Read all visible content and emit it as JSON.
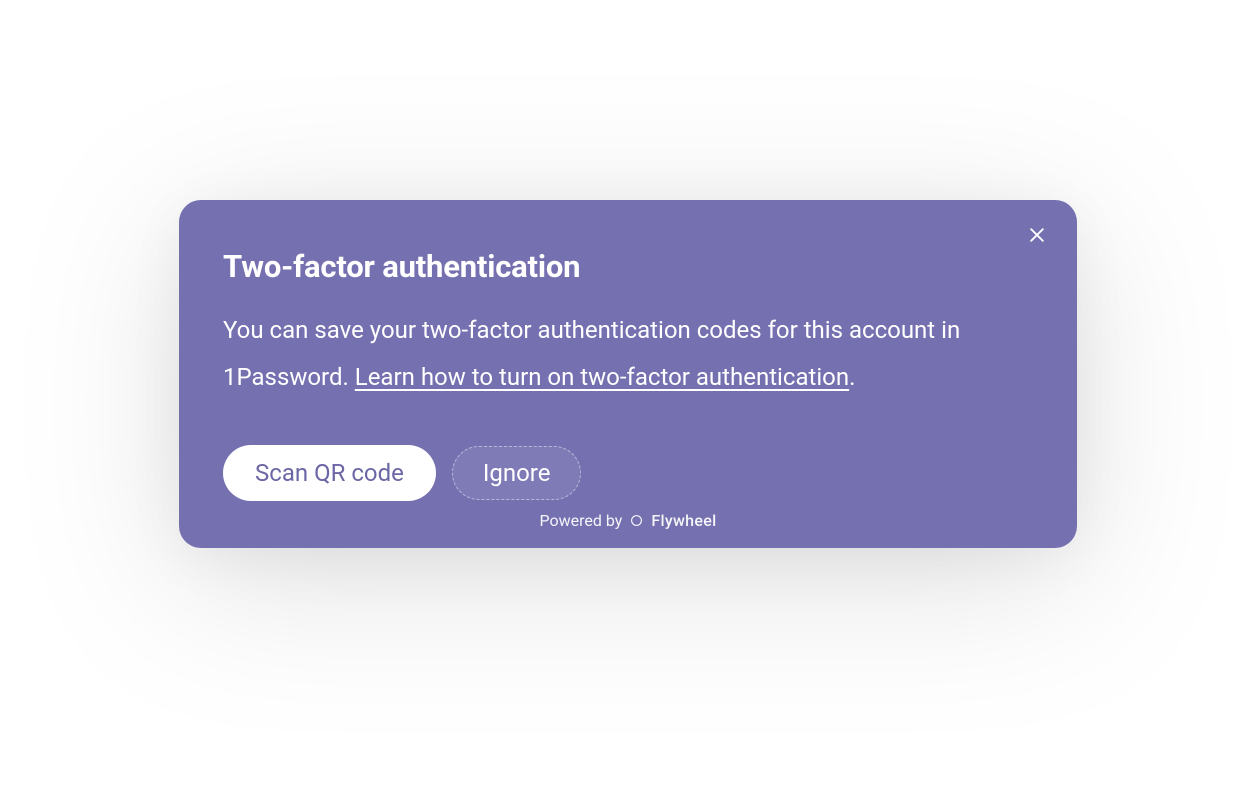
{
  "dialog": {
    "title": "Two-factor authentication",
    "description_prefix": "You can save your two-factor authentication codes for this account in 1Password. ",
    "learn_link_text": "Learn how to turn on two-factor authentication",
    "description_suffix": ".",
    "buttons": {
      "primary": "Scan QR code",
      "secondary": "Ignore"
    },
    "footer": {
      "powered_by": "Powered by",
      "brand": "Flywheel"
    }
  },
  "colors": {
    "dialog_bg": "#7570b0",
    "text": "#ffffff",
    "primary_button_bg": "#ffffff",
    "primary_button_text": "#6b66a5"
  }
}
